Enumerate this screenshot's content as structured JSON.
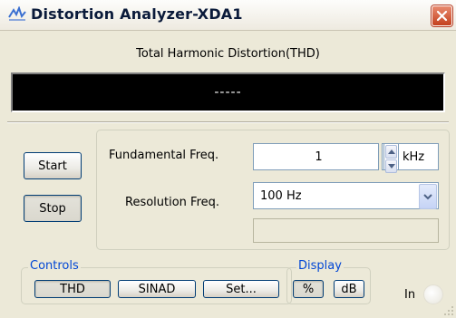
{
  "window": {
    "title": "Distortion Analyzer-XDA1",
    "close_icon": "close-icon"
  },
  "display": {
    "label": "Total Harmonic Distortion(THD)",
    "value": "-----"
  },
  "actions": {
    "start_label": "Start",
    "stop_label": "Stop",
    "stop_pressed": true
  },
  "settings": {
    "fundamental_label": "Fundamental Freq.",
    "fundamental_value": "1",
    "fundamental_unit": "kHz",
    "resolution_label": "Resolution Freq.",
    "resolution_value": "100 Hz",
    "extra_field_value": ""
  },
  "controls": {
    "legend": "Controls",
    "thd_label": "THD",
    "sinad_label": "SINAD",
    "set_label": "Set...",
    "active": "THD"
  },
  "display_group": {
    "legend": "Display",
    "percent_label": "%",
    "db_label": "dB",
    "active": "%"
  },
  "terminal": {
    "label": "In",
    "connected": false
  },
  "colors": {
    "legend_blue": "#0046d5",
    "close_red": "#c3401e",
    "display_bg": "#000000"
  }
}
